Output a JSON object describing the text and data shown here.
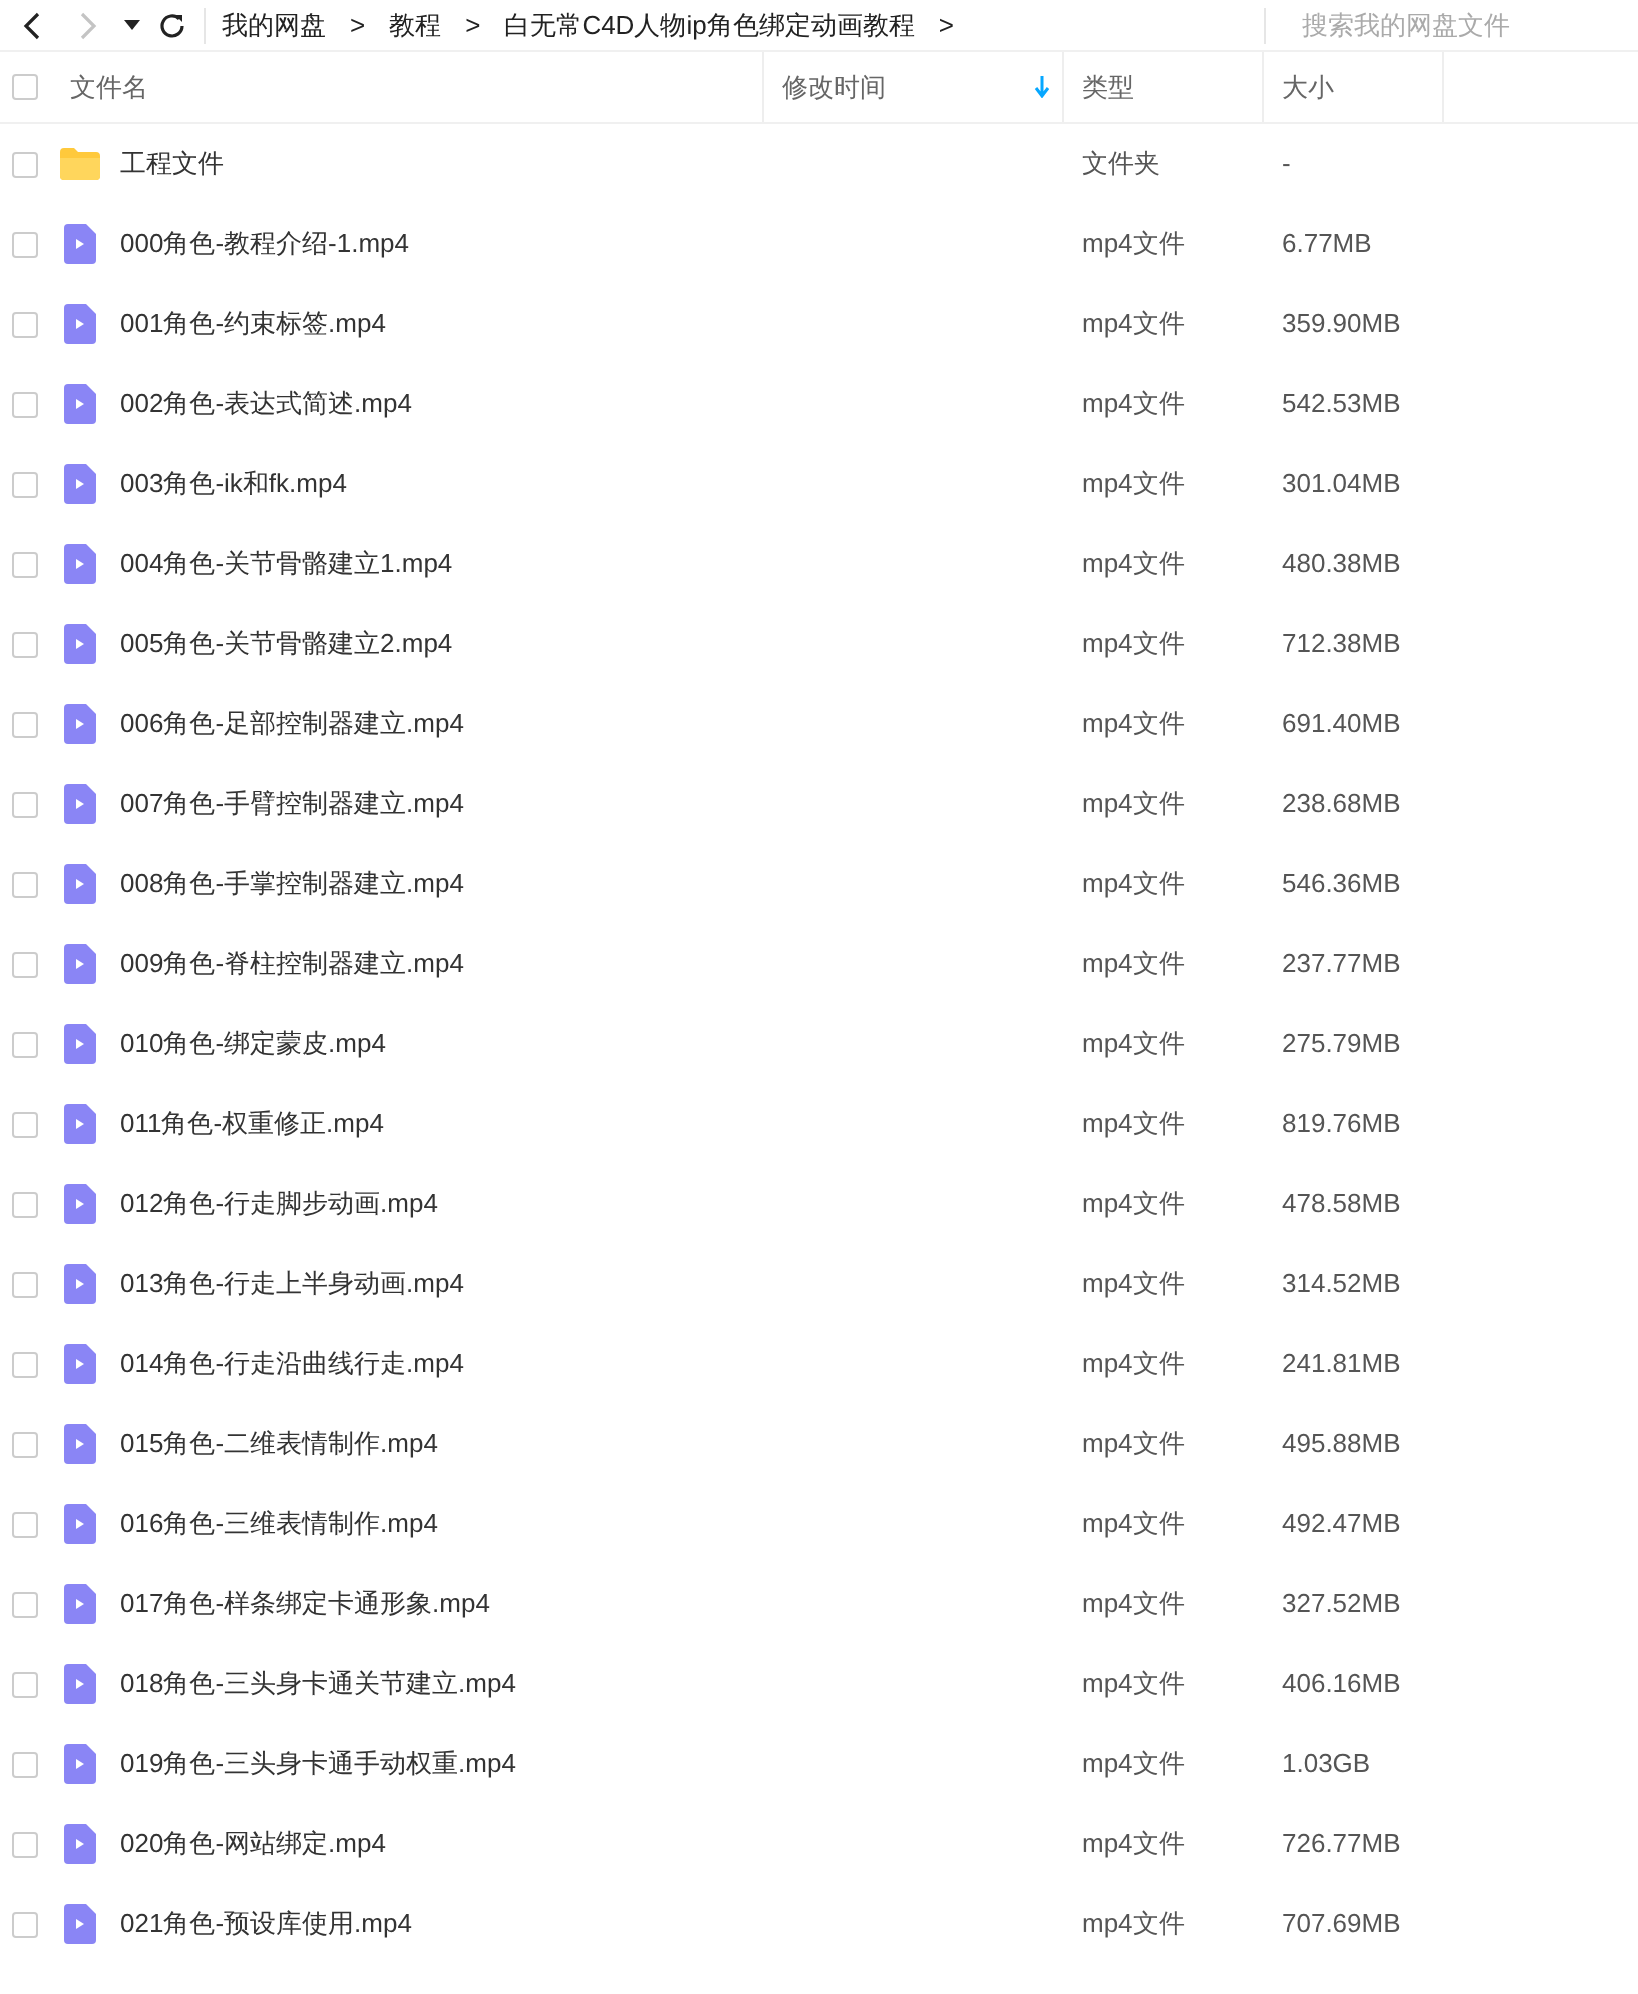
{
  "toolbar": {
    "back": {
      "disabled": false
    },
    "forward": {
      "disabled": true
    },
    "history_menu": {
      "disabled": false
    },
    "refresh": {
      "disabled": false
    }
  },
  "breadcrumbs": [
    {
      "label": "我的网盘",
      "separator": ">"
    },
    {
      "label": "教程",
      "separator": ">"
    },
    {
      "label": "白无常C4D人物ip角色绑定动画教程",
      "separator": ">"
    }
  ],
  "search": {
    "placeholder": "搜索我的网盘文件"
  },
  "select_all": {
    "checked": false
  },
  "columns": [
    {
      "label": "文件名",
      "sorted": false
    },
    {
      "label": "修改时间",
      "sorted": true
    },
    {
      "label": "类型",
      "sorted": false
    },
    {
      "label": "大小",
      "sorted": false
    }
  ],
  "rows": [
    {
      "kind": "folder",
      "name": "工程文件",
      "type": "文件夹",
      "size": "-",
      "checked": false
    },
    {
      "kind": "video",
      "name": "000角色-教程介绍-1.mp4",
      "type": "mp4文件",
      "size": "6.77MB",
      "checked": false
    },
    {
      "kind": "video",
      "name": "001角色-约束标签.mp4",
      "type": "mp4文件",
      "size": "359.90MB",
      "checked": false
    },
    {
      "kind": "video",
      "name": "002角色-表达式简述.mp4",
      "type": "mp4文件",
      "size": "542.53MB",
      "checked": false
    },
    {
      "kind": "video",
      "name": "003角色-ik和fk.mp4",
      "type": "mp4文件",
      "size": "301.04MB",
      "checked": false
    },
    {
      "kind": "video",
      "name": "004角色-关节骨骼建立1.mp4",
      "type": "mp4文件",
      "size": "480.38MB",
      "checked": false
    },
    {
      "kind": "video",
      "name": "005角色-关节骨骼建立2.mp4",
      "type": "mp4文件",
      "size": "712.38MB",
      "checked": false
    },
    {
      "kind": "video",
      "name": "006角色-足部控制器建立.mp4",
      "type": "mp4文件",
      "size": "691.40MB",
      "checked": false
    },
    {
      "kind": "video",
      "name": "007角色-手臂控制器建立.mp4",
      "type": "mp4文件",
      "size": "238.68MB",
      "checked": false
    },
    {
      "kind": "video",
      "name": "008角色-手掌控制器建立.mp4",
      "type": "mp4文件",
      "size": "546.36MB",
      "checked": false
    },
    {
      "kind": "video",
      "name": "009角色-脊柱控制器建立.mp4",
      "type": "mp4文件",
      "size": "237.77MB",
      "checked": false
    },
    {
      "kind": "video",
      "name": "010角色-绑定蒙皮.mp4",
      "type": "mp4文件",
      "size": "275.79MB",
      "checked": false
    },
    {
      "kind": "video",
      "name": "011角色-权重修正.mp4",
      "type": "mp4文件",
      "size": "819.76MB",
      "checked": false
    },
    {
      "kind": "video",
      "name": "012角色-行走脚步动画.mp4",
      "type": "mp4文件",
      "size": "478.58MB",
      "checked": false
    },
    {
      "kind": "video",
      "name": "013角色-行走上半身动画.mp4",
      "type": "mp4文件",
      "size": "314.52MB",
      "checked": false
    },
    {
      "kind": "video",
      "name": "014角色-行走沿曲线行走.mp4",
      "type": "mp4文件",
      "size": "241.81MB",
      "checked": false
    },
    {
      "kind": "video",
      "name": "015角色-二维表情制作.mp4",
      "type": "mp4文件",
      "size": "495.88MB",
      "checked": false
    },
    {
      "kind": "video",
      "name": "016角色-三维表情制作.mp4",
      "type": "mp4文件",
      "size": "492.47MB",
      "checked": false
    },
    {
      "kind": "video",
      "name": "017角色-样条绑定卡通形象.mp4",
      "type": "mp4文件",
      "size": "327.52MB",
      "checked": false
    },
    {
      "kind": "video",
      "name": "018角色-三头身卡通关节建立.mp4",
      "type": "mp4文件",
      "size": "406.16MB",
      "checked": false
    },
    {
      "kind": "video",
      "name": "019角色-三头身卡通手动权重.mp4",
      "type": "mp4文件",
      "size": "1.03GB",
      "checked": false
    },
    {
      "kind": "video",
      "name": "020角色-网站绑定.mp4",
      "type": "mp4文件",
      "size": "726.77MB",
      "checked": false
    },
    {
      "kind": "video",
      "name": "021角色-预设库使用.mp4",
      "type": "mp4文件",
      "size": "707.69MB",
      "checked": false
    }
  ]
}
